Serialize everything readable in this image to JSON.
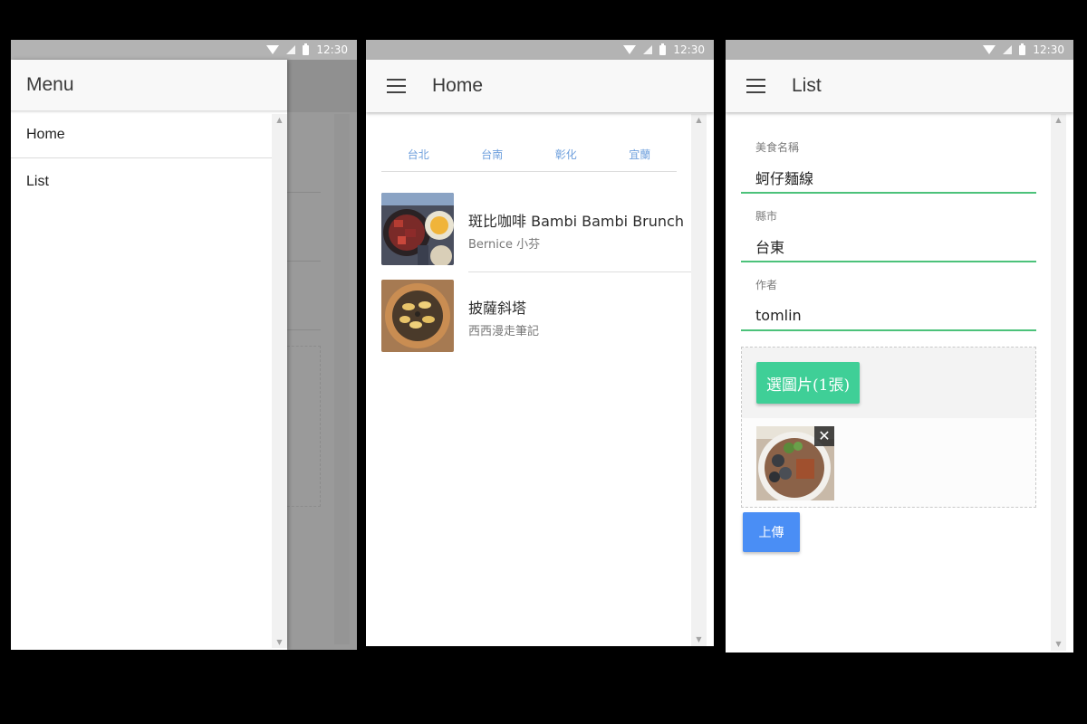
{
  "status_bar": {
    "time": "12:30"
  },
  "screen1": {
    "drawer_title": "Menu",
    "items": [
      {
        "label": "Home"
      },
      {
        "label": "List"
      }
    ]
  },
  "screen2": {
    "title": "Home",
    "tabs": [
      {
        "label": "台北"
      },
      {
        "label": "台南"
      },
      {
        "label": "彰化"
      },
      {
        "label": "宜蘭"
      }
    ],
    "items": [
      {
        "title": "斑比咖啡 Bambi Bambi Brunch",
        "author": "Bernice 小芬"
      },
      {
        "title": "披薩斜塔",
        "author": "西西漫走筆記"
      }
    ]
  },
  "screen3": {
    "title": "List",
    "fields": [
      {
        "label": "美食名稱",
        "value": "蚵仔麵線"
      },
      {
        "label": "縣市",
        "value": "台東"
      },
      {
        "label": "作者",
        "value": "tomlin"
      }
    ],
    "pick_button": "選圖片(1張)",
    "upload_button": "上傳"
  },
  "colors": {
    "accent_green": "#4cc27a",
    "pick_button": "#3fcf97",
    "upload_button": "#4a8ef5",
    "tab_text": "#6fa0dd"
  },
  "icons": {
    "menu": "hamburger-menu-icon",
    "remove": "close-icon",
    "status": [
      "wifi-icon",
      "signal-icon",
      "battery-icon"
    ]
  }
}
